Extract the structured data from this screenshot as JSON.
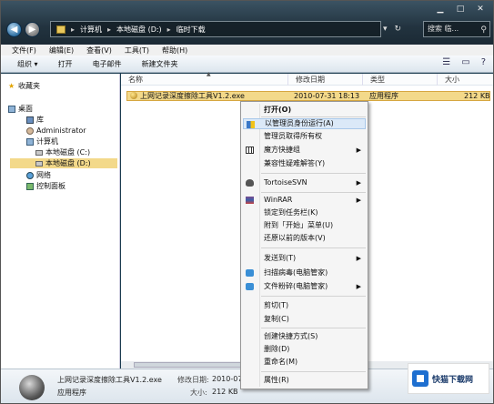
{
  "window": {
    "address": [
      "计算机",
      "本地磁盘 (D:)",
      "临时下载"
    ],
    "search_placeholder": "搜索 临...",
    "controls": [
      "▾",
      "↻"
    ]
  },
  "menubar": [
    "文件(F)",
    "编辑(E)",
    "查看(V)",
    "工具(T)",
    "帮助(H)"
  ],
  "toolbar": {
    "organize": "组织 ▾",
    "open": "打开",
    "email": "电子邮件",
    "new_folder": "新建文件夹"
  },
  "nav": {
    "favorites": "收藏夹",
    "desktop": "桌面",
    "library": "库",
    "admin": "Administrator",
    "computer": "计算机",
    "drive_c": "本地磁盘 (C:)",
    "drive_d": "本地磁盘 (D:)",
    "network": "网络",
    "control_panel": "控制面板"
  },
  "columns": {
    "name": "名称",
    "date": "修改日期",
    "type": "类型",
    "size": "大小"
  },
  "file": {
    "name": "上网记录深度擦除工具V1.2.exe",
    "date": "2010-07-31 18:13",
    "type": "应用程序",
    "size": "212 KB"
  },
  "details": {
    "filename": "上网记录深度擦除工具V1.2.exe",
    "date_label": "修改日期:",
    "date_value": "2010-07-...",
    "type": "应用程序",
    "size_label": "大小:",
    "size_value": "212 KB"
  },
  "watermark": "快猫下载网",
  "context_menu": [
    {
      "label": "打开(O)",
      "bold": true
    },
    {
      "label": "以管理员身份运行(A)",
      "icon": "uac-shield-icon",
      "highlight": true
    },
    {
      "label": "管理员取得所有权"
    },
    {
      "label": "魔方快捷组",
      "icon": "grid-icon",
      "submenu": true
    },
    {
      "label": "兼容性疑难解答(Y)"
    },
    {
      "label": "TortoiseSVN",
      "icon": "turtle-icon",
      "submenu": true
    },
    {
      "label": "WinRAR",
      "icon": "winrar-icon",
      "submenu": true
    },
    {
      "label": "锁定到任务栏(K)"
    },
    {
      "label": "附到「开始」菜单(U)"
    },
    {
      "label": "还原以前的版本(V)"
    },
    {
      "label": "发送到(T)",
      "submenu": true
    },
    {
      "label": "扫描病毒(电脑管家)",
      "icon": "guard-icon"
    },
    {
      "label": "文件粉碎(电脑管家)",
      "icon": "guard-icon",
      "submenu": true
    },
    {
      "label": "剪切(T)"
    },
    {
      "label": "复制(C)"
    },
    {
      "label": "创建快捷方式(S)"
    },
    {
      "label": "删除(D)"
    },
    {
      "label": "重命名(M)"
    },
    {
      "label": "属性(R)"
    }
  ]
}
